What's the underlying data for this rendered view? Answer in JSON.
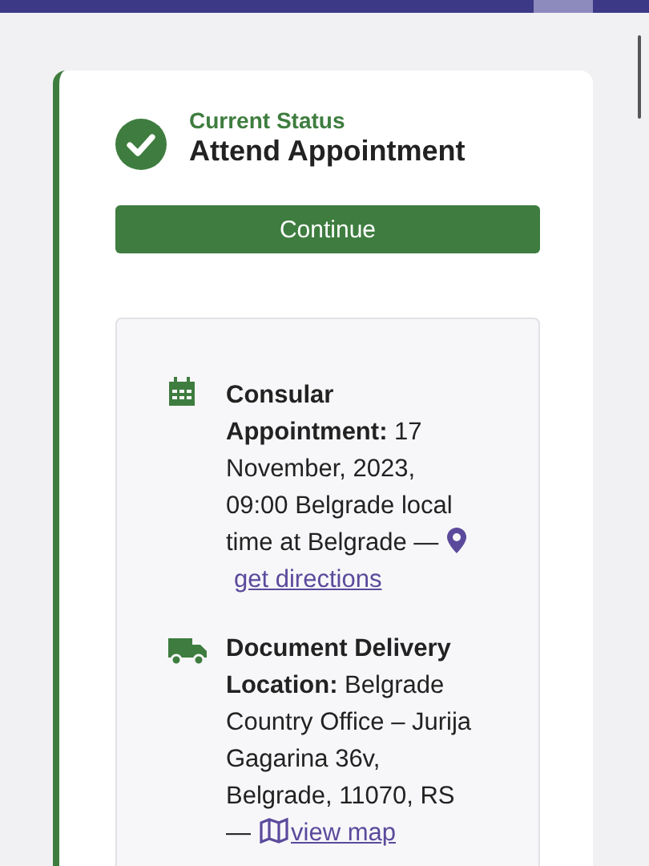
{
  "status": {
    "label": "Current Status",
    "title": "Attend Appointment",
    "done": true
  },
  "button": "Continue",
  "details": [
    {
      "kind": "appointment",
      "text": "**Consular Appointment:** 17 November, 2023, 09:00 Belgrade local time at Belgrade —",
      "link": "get directions"
    },
    {
      "kind": "delivery",
      "text": "**Document Delivery Location:** Belgrade Country Office – Jurija Gagarina 36v, Belgrade, 11070, RS —",
      "link": "view map"
    }
  ]
}
